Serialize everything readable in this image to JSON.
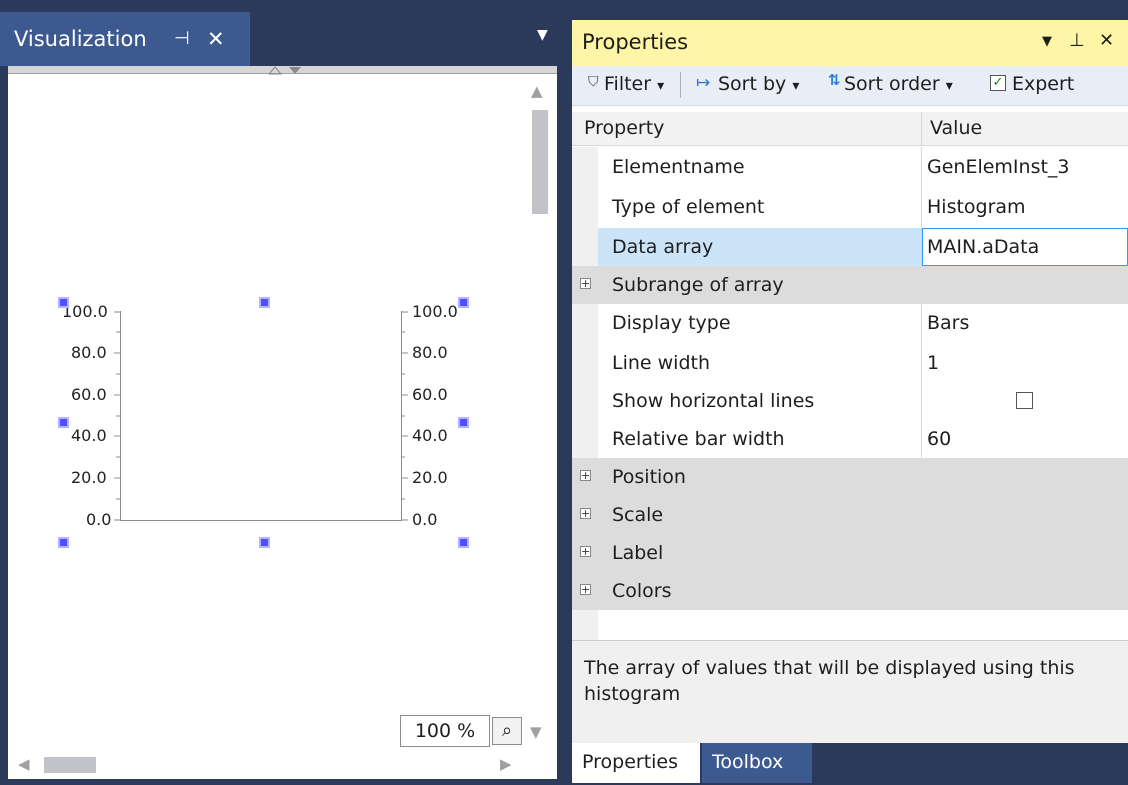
{
  "visualization": {
    "title": "Visualization",
    "pin_glyph": "⊣",
    "close_glyph": "✕",
    "menu_glyph": "▼",
    "zoom_value": "100 %",
    "zoom_icon": "⌕",
    "chart_labels": {
      "left_ticks": [
        "100.0",
        "80.0",
        "60.0",
        "40.0",
        "20.0",
        "0.0"
      ],
      "right_ticks": [
        "100.0",
        "80.0",
        "60.0",
        "40.0",
        "20.0",
        "0.0"
      ]
    }
  },
  "properties": {
    "title": "Properties",
    "header_icons": {
      "menu": "▼",
      "pin": "⊥",
      "close": "✕"
    },
    "toolbar": {
      "filter": "Filter",
      "sort_by": "Sort by",
      "sort_order": "Sort order",
      "expert": "Expert",
      "dropdown": "▾"
    },
    "columns": {
      "property": "Property",
      "value": "Value"
    },
    "rows": [
      {
        "label": "Elementname",
        "value": "GenElemInst_3",
        "group": false
      },
      {
        "label": "Type of element",
        "value": "Histogram",
        "group": false
      },
      {
        "label": "Data array",
        "value": "MAIN.aData",
        "group": false,
        "selected": true
      },
      {
        "label": "Subrange of array",
        "value": "",
        "group": true
      },
      {
        "label": "Display type",
        "value": "Bars",
        "group": false
      },
      {
        "label": "Line width",
        "value": "1",
        "group": false
      },
      {
        "label": "Show horizontal lines",
        "value": "",
        "group": false,
        "checkbox": true
      },
      {
        "label": "Relative bar width",
        "value": "60",
        "group": false
      },
      {
        "label": "Position",
        "value": "",
        "group": true
      },
      {
        "label": "Scale",
        "value": "",
        "group": true
      },
      {
        "label": "Label",
        "value": "",
        "group": true
      },
      {
        "label": "Colors",
        "value": "",
        "group": true
      }
    ],
    "description": "The array of values that will be displayed using this histogram",
    "bottom_tabs": [
      "Properties",
      "Toolbox"
    ]
  },
  "colors": {
    "chrome": "#2b3a5b",
    "active_tab": "#3d5a90",
    "properties_header": "#fef5a6",
    "selected_cell": "#cce4f7",
    "selected_value_border": "#3399ff",
    "handle": "#4f4fff"
  }
}
